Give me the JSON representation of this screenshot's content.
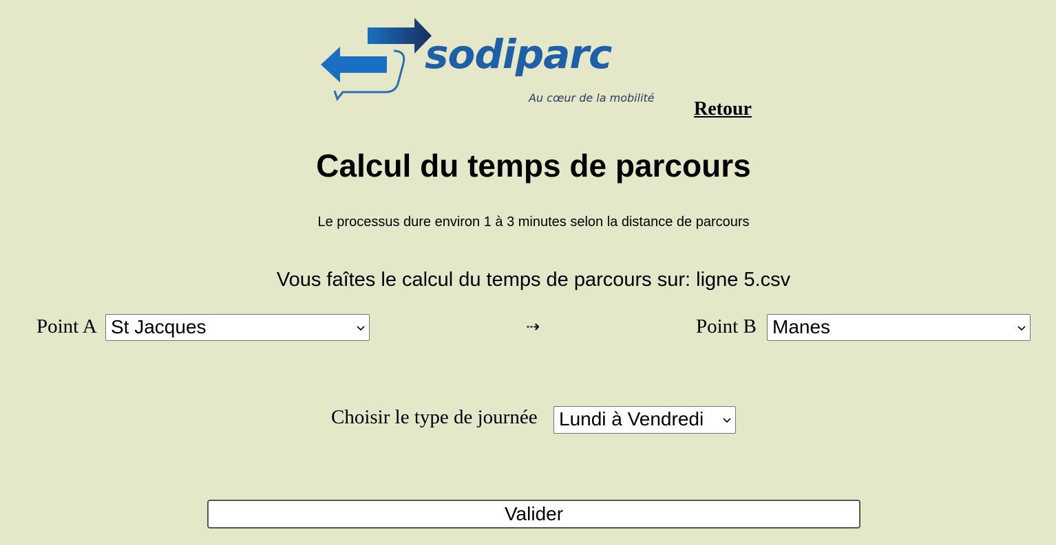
{
  "header": {
    "logo": {
      "brand_name": "sodiparc",
      "tagline": "Au cœur de la mobilité",
      "colors": {
        "primary": "#1f5fa8",
        "dark": "#1b2e5c"
      }
    },
    "back_link_label": "Retour"
  },
  "main": {
    "title": "Calcul du temps de parcours",
    "subtitle": "Le processus dure environ 1 à 3 minutes selon la distance de parcours",
    "file_info": "Vous faîtes le calcul du temps de parcours sur: ligne 5.csv",
    "point_a": {
      "label": "Point A",
      "selected": "St Jacques"
    },
    "arrow": "⇢",
    "point_b": {
      "label": "Point B",
      "selected": "Manes"
    },
    "day_type": {
      "label": "Choisir le type de journée",
      "selected": "Lundi à Vendredi"
    },
    "submit_label": "Valider"
  },
  "colors": {
    "background": "#e5e7c9"
  }
}
